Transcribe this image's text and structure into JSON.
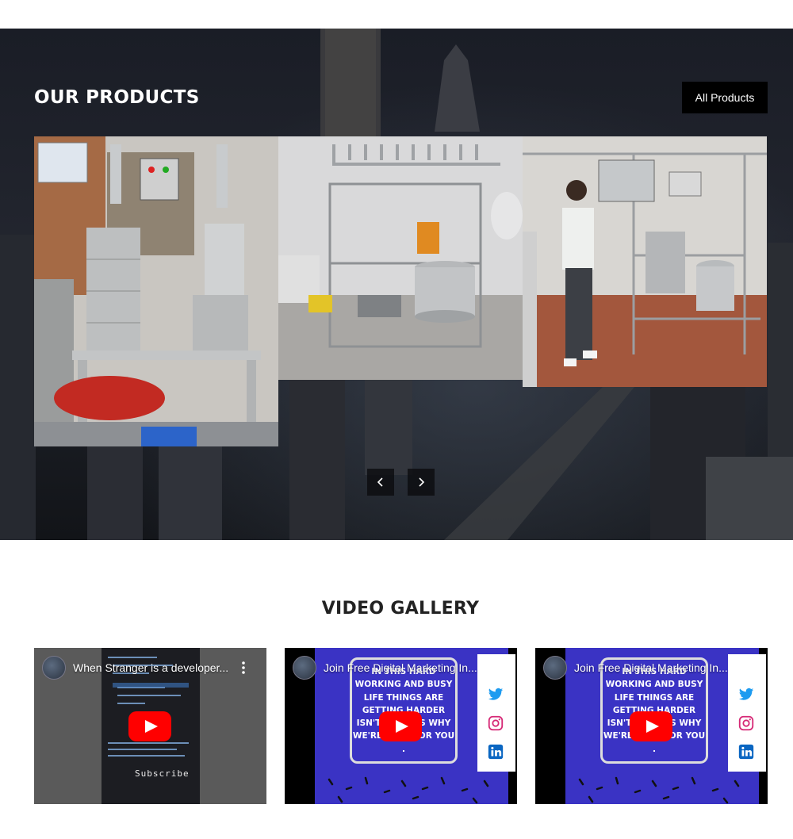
{
  "products": {
    "title": "OUR PRODUCTS",
    "all_products_label": "All Products",
    "nav": {
      "prev": "‹",
      "next": "›"
    }
  },
  "gallery": {
    "title": "VIDEO GALLERY",
    "videos": [
      {
        "title": "When Stranger is a developer...",
        "overlay": "Subscribe"
      },
      {
        "title": "Join Free Digital Marketing In...",
        "overlay": "IN THIS HARD WORKING AND BUSY LIFE THINGS ARE GETTING HARDER ISN'T IT THATS WHY WE'RE HERE FOR YOU ."
      },
      {
        "title": "Join Free Digital Marketing In...",
        "overlay": "IN THIS HARD WORKING AND BUSY LIFE THINGS ARE GETTING HARDER ISN'T IT THATS WHY WE'RE HERE FOR YOU ."
      }
    ]
  },
  "colors": {
    "section_bg": "#1b1e25",
    "button_bg": "#000000",
    "youtube_red": "#ff0000",
    "promo_blue": "#3a33c4"
  }
}
